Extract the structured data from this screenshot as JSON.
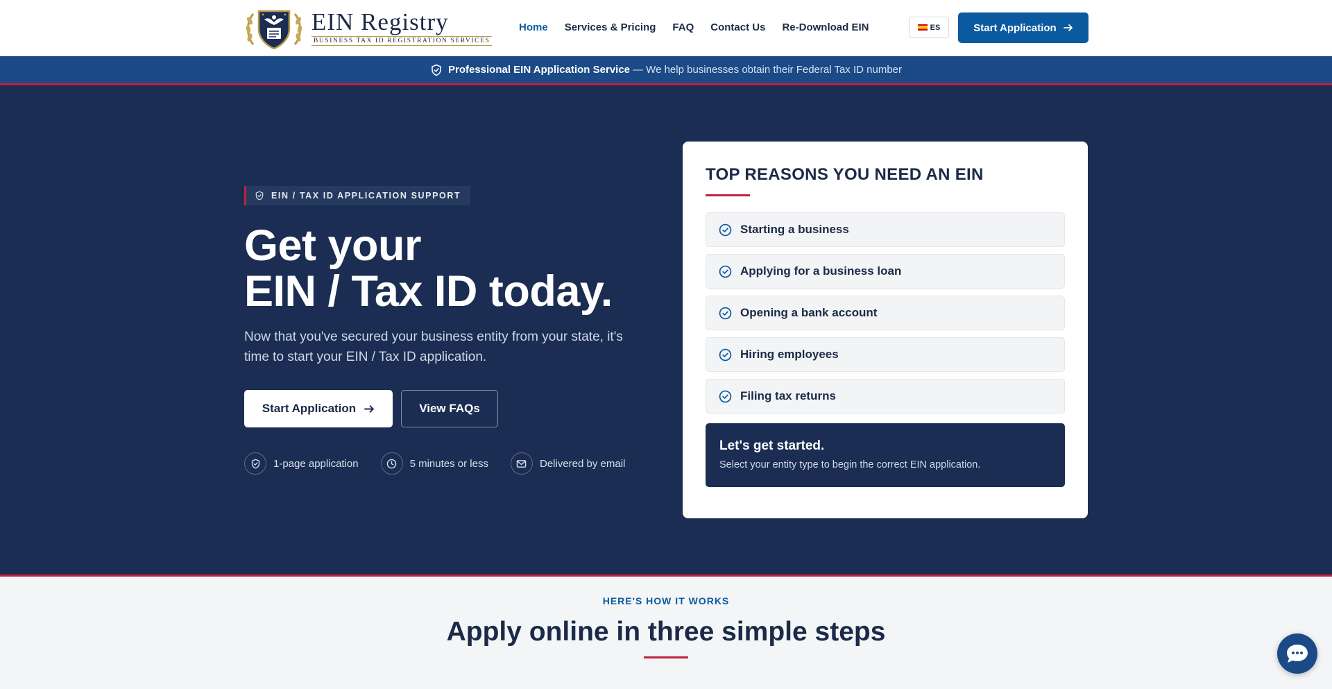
{
  "brand": {
    "title": "EIN Registry",
    "subtitle": "Business Tax ID Registration Services"
  },
  "nav": {
    "items": [
      {
        "label": "Home",
        "active": true
      },
      {
        "label": "Services & Pricing"
      },
      {
        "label": "FAQ"
      },
      {
        "label": "Contact Us"
      },
      {
        "label": "Re-Download EIN"
      }
    ],
    "language": "ES",
    "cta": "Start Application"
  },
  "banner": {
    "strong": "Professional EIN Application Service",
    "text": "— We help businesses obtain their Federal Tax ID number"
  },
  "hero": {
    "tag": "EIN / TAX ID APPLICATION SUPPORT",
    "title_line1": "Get your",
    "title_line2": "EIN / Tax ID today.",
    "description": "Now that you've secured your business entity from your state, it's time to start your EIN / Tax ID application.",
    "primary_button": "Start Application",
    "secondary_button": "View FAQs",
    "features": [
      {
        "icon": "shield-check-icon",
        "label": "1-page application"
      },
      {
        "icon": "clock-icon",
        "label": "5 minutes or less"
      },
      {
        "icon": "mail-icon",
        "label": "Delivered by email"
      }
    ]
  },
  "reasons_card": {
    "title": "TOP REASONS YOU NEED AN EIN",
    "items": [
      "Starting a business",
      "Applying for a business loan",
      "Opening a bank account",
      "Hiring employees",
      "Filing tax returns"
    ],
    "start_title": "Let's get started.",
    "start_subtitle": "Select your entity type to begin the correct EIN application."
  },
  "how_it_works": {
    "kicker": "HERE'S HOW IT WORKS",
    "title": "Apply online in three simple steps"
  },
  "colors": {
    "navy": "#1b2d52",
    "blue": "#0b5aa0",
    "red": "#c0213d"
  }
}
